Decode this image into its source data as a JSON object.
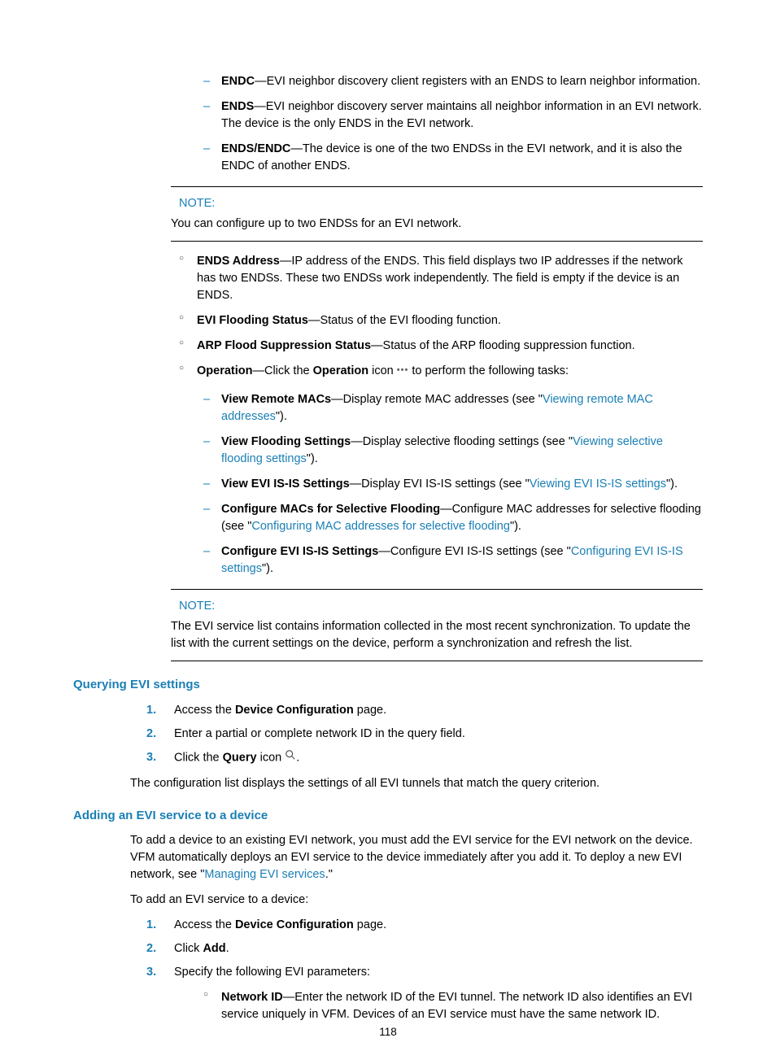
{
  "topDash": [
    {
      "term": "ENDC",
      "desc": "—EVI neighbor discovery client registers with an ENDS to learn neighbor information."
    },
    {
      "term": "ENDS",
      "desc": "—EVI neighbor discovery server maintains all neighbor information in an EVI network. The device is the only ENDS in the EVI network."
    },
    {
      "term": "ENDS/ENDC",
      "desc": "—The device is one of the two ENDSs in the EVI network, and it is also the ENDC of another ENDS."
    }
  ],
  "note1": {
    "label": "NOTE:",
    "text": "You can configure up to two ENDSs for an EVI network."
  },
  "circle": {
    "endsAddr": {
      "term": "ENDS Address",
      "desc": "—IP address of the ENDS. This field displays two IP addresses if the network has two ENDSs. These two ENDSs work independently. The field is empty if the device is an ENDS."
    },
    "eviFlood": {
      "term": "EVI Flooding Status",
      "desc": "—Status of the EVI flooding function."
    },
    "arpFlood": {
      "term": "ARP Flood Suppression Status",
      "desc": "—Status of the ARP flooding suppression function."
    },
    "operation": {
      "term": "Operation",
      "pre": "—Click the ",
      "bold1": "Operation",
      "mid": " icon ",
      "post": " to perform the following tasks:"
    }
  },
  "opDash": {
    "viewMac": {
      "term": "View Remote MACs",
      "pre": "—Display remote MAC addresses (see \"",
      "link": "Viewing remote MAC addresses",
      "post": "\")."
    },
    "viewFlood": {
      "term": "View Flooding Settings",
      "pre": "—Display selective flooding settings (see \"",
      "link": "Viewing selective flooding settings",
      "post": "\")."
    },
    "viewIsis": {
      "term": "View EVI IS-IS Settings",
      "pre": "—Display EVI IS-IS settings (see \"",
      "link": "Viewing EVI IS-IS settings",
      "post": "\")."
    },
    "confMac": {
      "term": "Configure MACs for Selective Flooding",
      "pre": "—Configure MAC addresses for selective flooding (see \"",
      "link": "Configuring MAC addresses for selective flooding",
      "post": "\")."
    },
    "confIsis": {
      "term": "Configure EVI IS-IS Settings",
      "pre": "—Configure EVI IS-IS settings (see \"",
      "link": "Configuring EVI IS-IS settings",
      "post": "\")."
    }
  },
  "note2": {
    "label": "NOTE:",
    "text": "The EVI service list contains information collected in the most recent synchronization. To update the list with the current settings on the device, perform a synchronization and refresh the list."
  },
  "queryHeading": "Querying EVI settings",
  "queryOl": {
    "s1pre": "Access the ",
    "s1bold": "Device Configuration",
    "s1post": " page.",
    "s2": "Enter a partial or complete network ID in the query field.",
    "s3pre": "Click the ",
    "s3bold": "Query",
    "s3mid": " icon ",
    "s3post": "."
  },
  "queryPara": "The configuration list displays the settings of all EVI tunnels that match the query criterion.",
  "addHeading": "Adding an EVI service to a device",
  "addPara1": {
    "pre": "To add a device to an existing EVI network, you must add the EVI service for the EVI network on the device. VFM automatically deploys an EVI service to the device immediately after you add it. To deploy a new EVI network, see \"",
    "link": "Managing EVI services",
    "post": ".\""
  },
  "addPara2": "To add an EVI service to a device:",
  "addOl": {
    "s1pre": "Access the ",
    "s1bold": "Device Configuration",
    "s1post": " page.",
    "s2pre": "Click ",
    "s2bold": "Add",
    "s2post": ".",
    "s3": "Specify the following EVI parameters:"
  },
  "addCircle": {
    "term": "Network ID",
    "desc": "—Enter the network ID of the EVI tunnel. The network ID also identifies an EVI service uniquely in VFM. Devices of an EVI service must have the same network ID."
  },
  "pageNum": "118"
}
